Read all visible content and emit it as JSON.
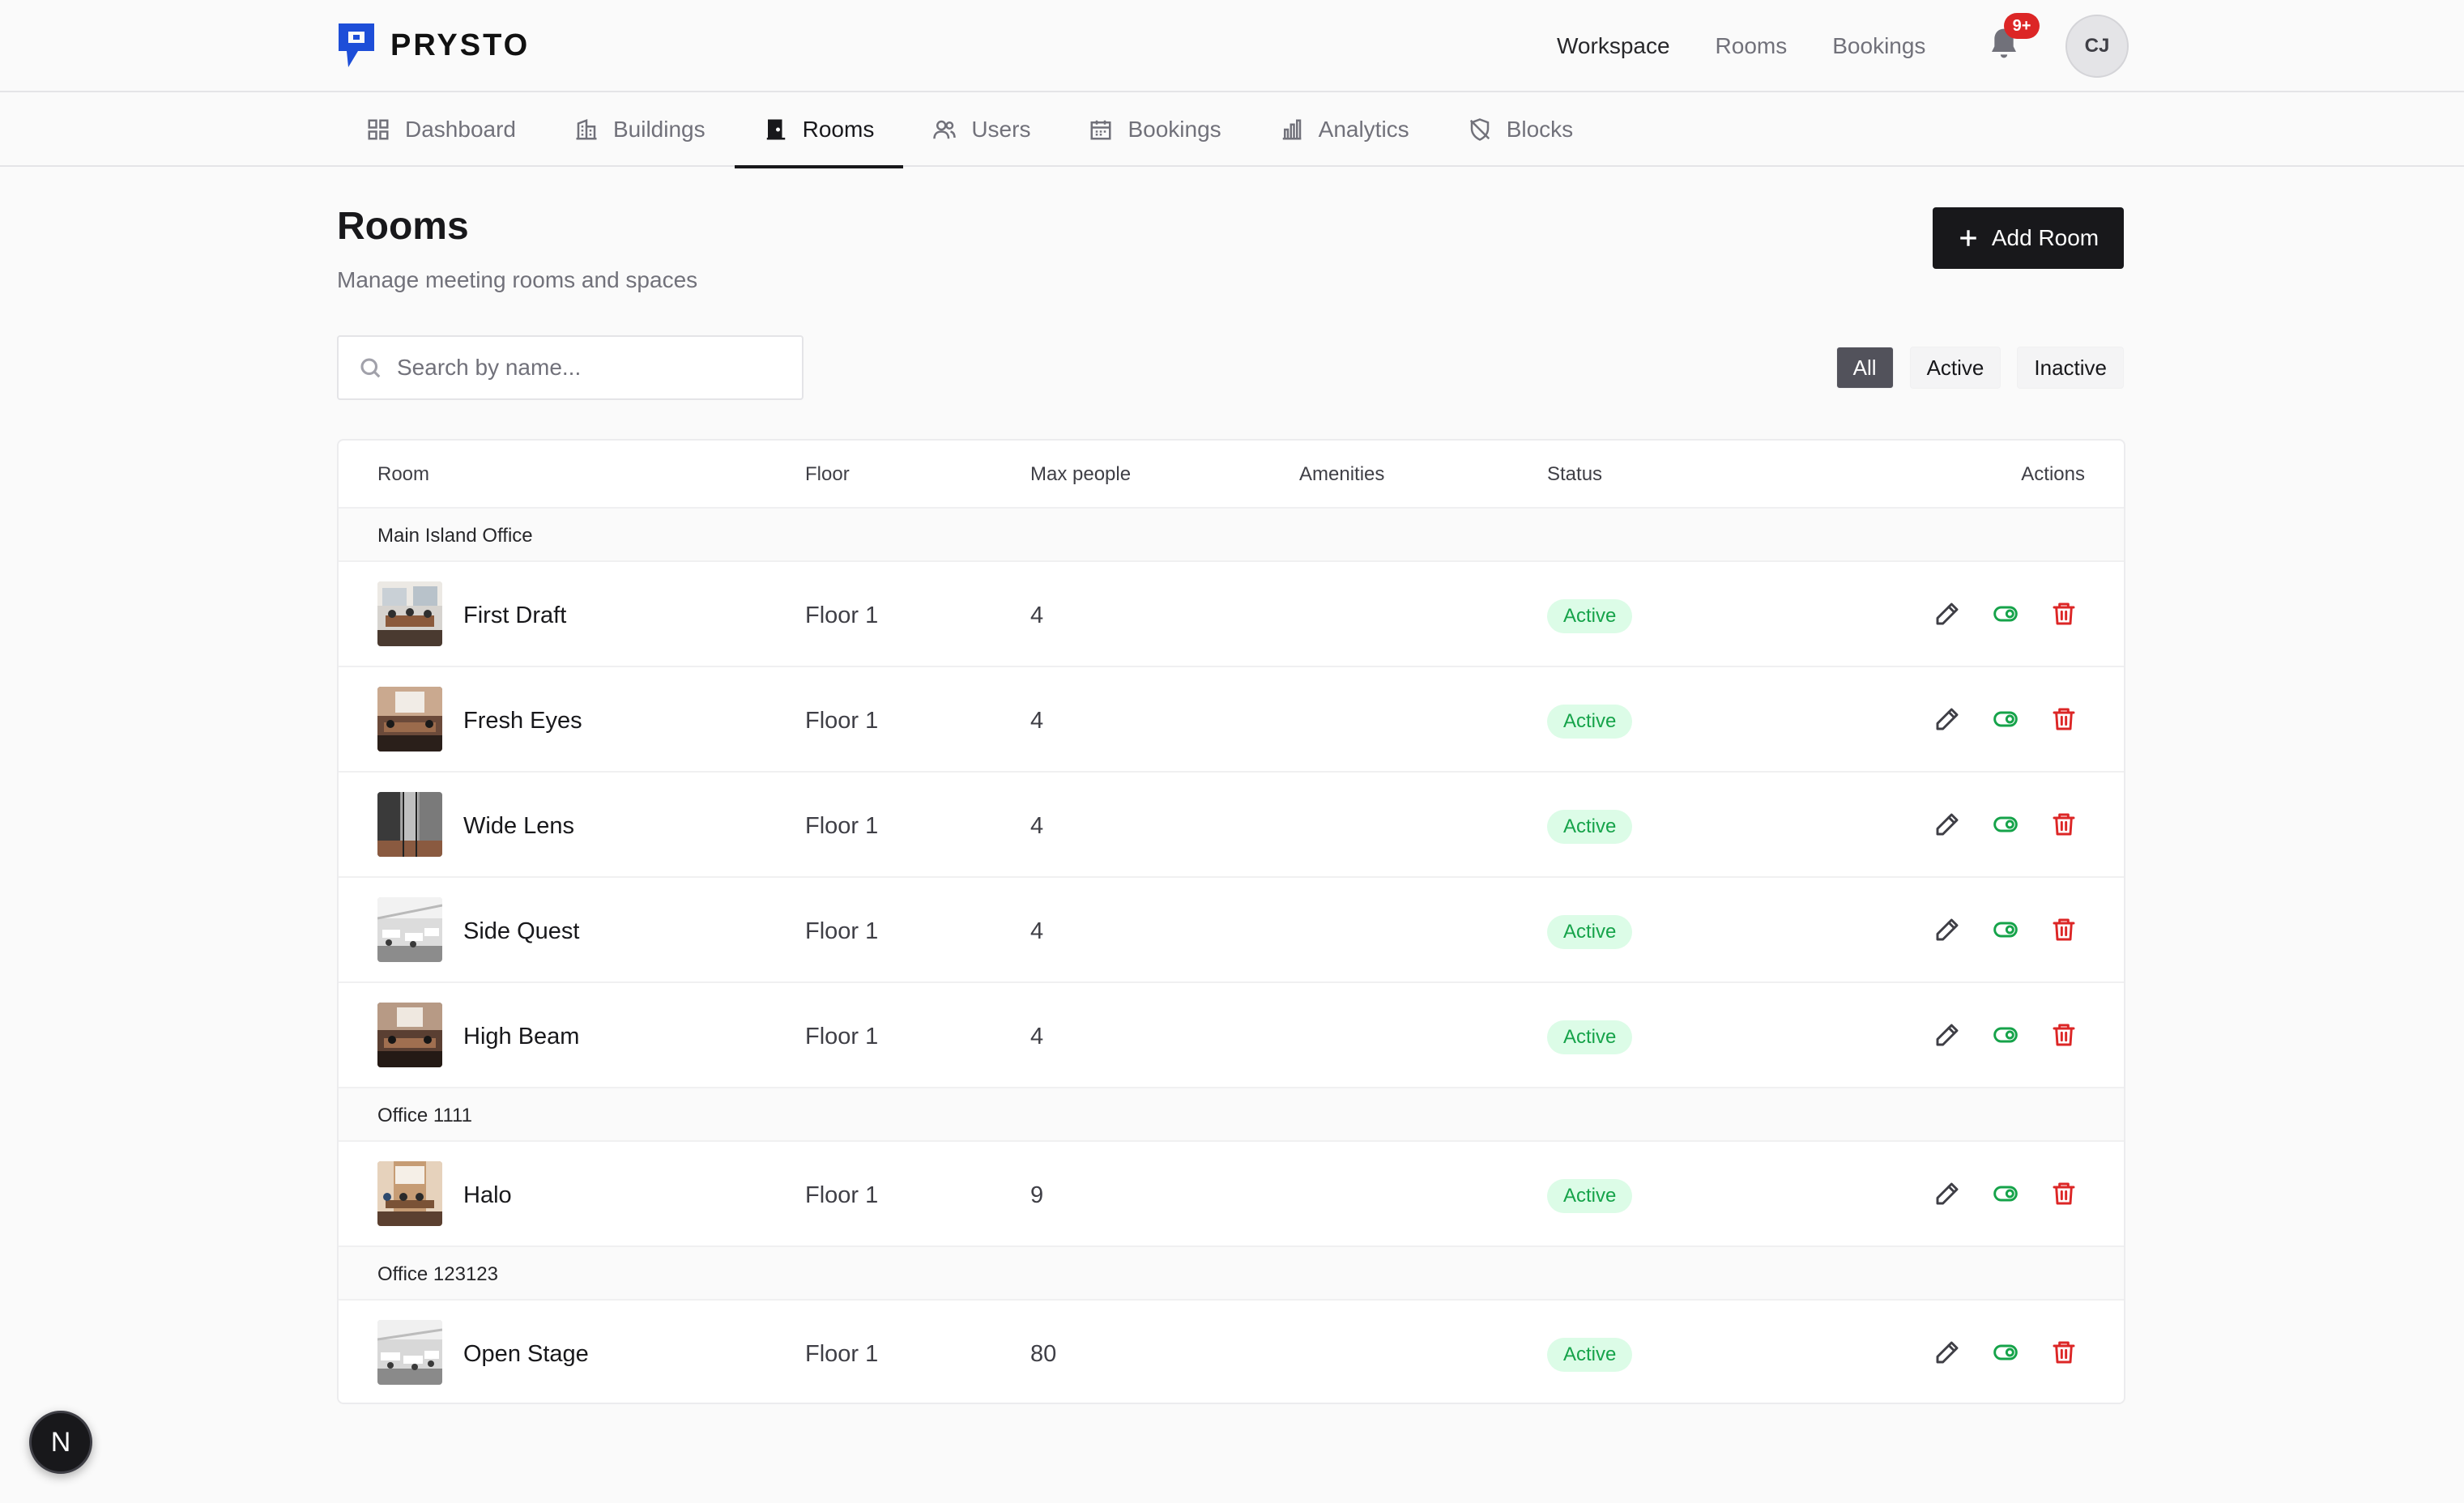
{
  "brand": {
    "name": "PRYSTO",
    "color": "#1d4ed8"
  },
  "topnav": {
    "items": [
      {
        "label": "Workspace"
      },
      {
        "label": "Rooms"
      },
      {
        "label": "Bookings"
      }
    ],
    "notification_count": "9+",
    "avatar_initials": "CJ"
  },
  "subnav": {
    "tabs": [
      {
        "label": "Dashboard",
        "icon": "grid-icon"
      },
      {
        "label": "Buildings",
        "icon": "building-icon"
      },
      {
        "label": "Rooms",
        "icon": "door-icon",
        "active": true
      },
      {
        "label": "Users",
        "icon": "users-icon"
      },
      {
        "label": "Bookings",
        "icon": "calendar-icon"
      },
      {
        "label": "Analytics",
        "icon": "chart-icon"
      },
      {
        "label": "Blocks",
        "icon": "shield-off-icon"
      }
    ]
  },
  "page": {
    "title": "Rooms",
    "subtitle": "Manage meeting rooms and spaces",
    "add_button": "Add Room"
  },
  "search": {
    "placeholder": "Search by name...",
    "value": ""
  },
  "filters": [
    {
      "label": "All",
      "selected": true
    },
    {
      "label": "Active"
    },
    {
      "label": "Inactive"
    }
  ],
  "table": {
    "columns": [
      "Room",
      "Floor",
      "Max people",
      "Amenities",
      "Status",
      "Actions"
    ],
    "groups": [
      {
        "name": "Main Island Office",
        "rooms": [
          {
            "name": "First Draft",
            "floor": "Floor 1",
            "max": "4",
            "amenities": "",
            "status": "Active"
          },
          {
            "name": "Fresh Eyes",
            "floor": "Floor 1",
            "max": "4",
            "amenities": "",
            "status": "Active"
          },
          {
            "name": "Wide Lens",
            "floor": "Floor 1",
            "max": "4",
            "amenities": "",
            "status": "Active"
          },
          {
            "name": "Side Quest",
            "floor": "Floor 1",
            "max": "4",
            "amenities": "",
            "status": "Active"
          },
          {
            "name": "High Beam",
            "floor": "Floor 1",
            "max": "4",
            "amenities": "",
            "status": "Active"
          }
        ]
      },
      {
        "name": "Office 1111",
        "rooms": [
          {
            "name": "Halo",
            "floor": "Floor 1",
            "max": "9",
            "amenities": "",
            "status": "Active"
          }
        ]
      },
      {
        "name": "Office 123123",
        "rooms": [
          {
            "name": "Open Stage",
            "floor": "Floor 1",
            "max": "80",
            "amenities": "",
            "status": "Active"
          }
        ]
      }
    ]
  },
  "dev_badge": "N",
  "colors": {
    "accent": "#18181b",
    "active_bg": "#dcfce7",
    "active_text": "#16a34a",
    "danger": "#dc2626"
  }
}
